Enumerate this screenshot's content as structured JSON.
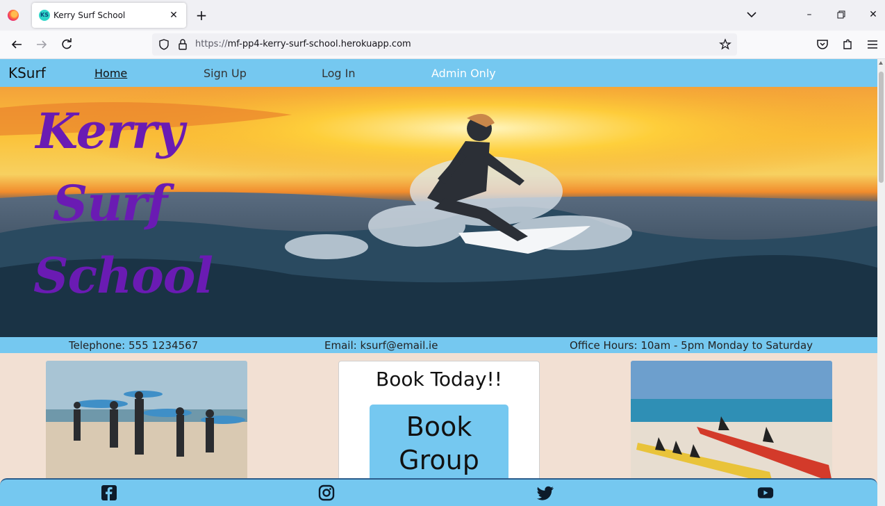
{
  "browser": {
    "tab_title": "Kerry Surf School",
    "tab_favicon_text": "KS",
    "url_scheme": "https://",
    "url_host": "mf-pp4-kerry-surf-school.herokuapp.com"
  },
  "site": {
    "brand": "KSurf",
    "nav": [
      "Home",
      "Sign Up",
      "Log In",
      "Admin Only"
    ],
    "hero_title": [
      "Kerry",
      "Surf",
      "School"
    ],
    "contact": {
      "telephone": "Telephone: 555 1234567",
      "email": "Email: ksurf@email.ie",
      "hours": "Office Hours: 10am - 5pm Monday to Saturday"
    },
    "book": {
      "heading": "Book Today!!",
      "button_line1": "Book",
      "button_line2": "Group"
    },
    "social": [
      "facebook-icon",
      "instagram-icon",
      "twitter-icon",
      "youtube-icon"
    ]
  },
  "colors": {
    "nav_bg": "#75c8f0",
    "page_bg": "#f2e0d3",
    "title_purple": "#6a1bb3"
  }
}
